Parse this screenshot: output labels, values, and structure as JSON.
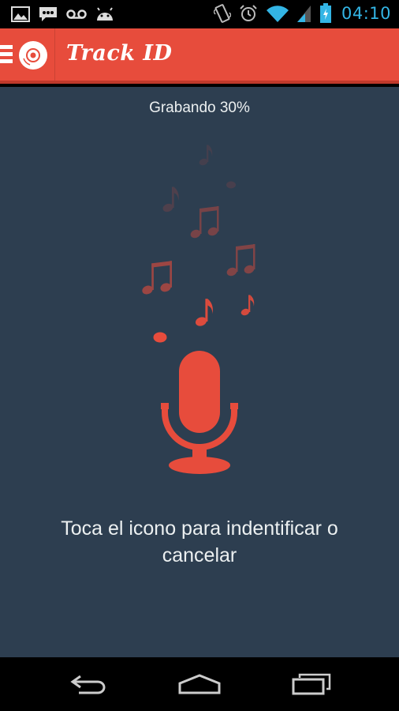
{
  "status_bar": {
    "time": "04:10",
    "left_icons": [
      "image-icon",
      "message-icon",
      "voicemail-icon",
      "android-icon"
    ],
    "right_icons": [
      "vibrate-icon",
      "alarm-icon",
      "wifi-icon",
      "signal-icon",
      "battery-charging-icon"
    ],
    "accent_color": "#33b5e5"
  },
  "app_bar": {
    "title": "Track ID",
    "background_color": "#e74c3c"
  },
  "main": {
    "recording_status": "Grabando 30%",
    "recording_progress_percent": 30,
    "instruction": "Toca el icono para indentificar o cancelar",
    "background_color": "#2d3e50",
    "accent_color": "#e74c3c"
  },
  "nav_bar": {
    "buttons": [
      "back-icon",
      "home-icon",
      "recent-apps-icon"
    ]
  }
}
